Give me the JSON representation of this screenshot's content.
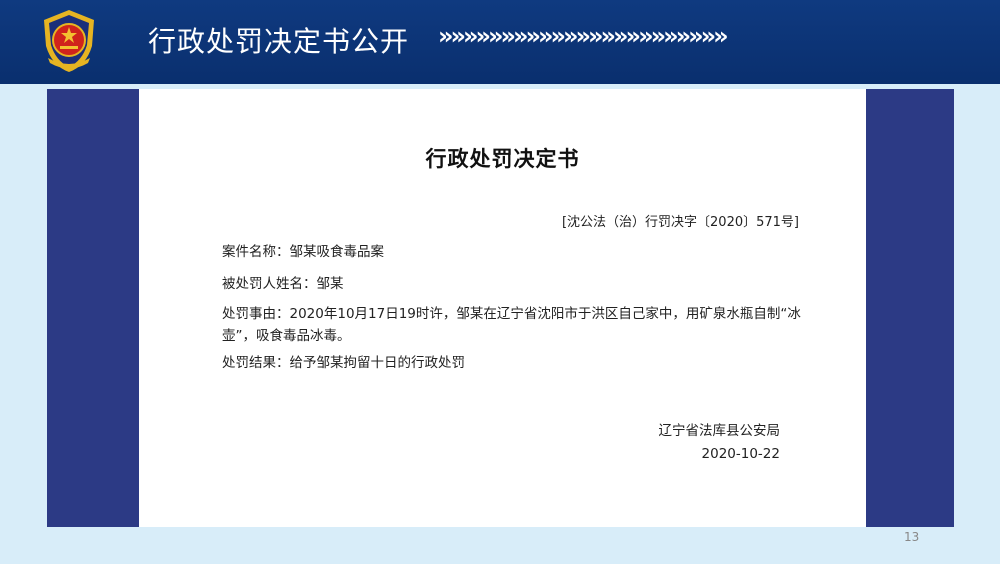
{
  "header": {
    "title": "行政处罚决定书公开",
    "chevrons": "»»»»»»»»»»»»»»»»»»»»»»»",
    "emblem_icon": "police-emblem-icon"
  },
  "document": {
    "title": "行政处罚决定书",
    "number": "[沈公法（治）行罚决字〔2020〕571号]",
    "case_name_label": "案件名称：",
    "case_name": "邹某吸食毒品案",
    "person_label": "被处罚人姓名：",
    "person": "邹某",
    "reason_label": "处罚事由：",
    "reason": "2020年10月17日19时许，邹某在辽宁省沈阳市于洪区自己家中，用矿泉水瓶自制“冰壶”，吸食毒品冰毒。",
    "result_label": "处罚结果：",
    "result": "给予邹某拘留十日的行政处罚",
    "issuer": "辽宁省法库县公安局",
    "date": "2020-10-22"
  },
  "page_number": "13",
  "colors": {
    "header": "#0f3a80",
    "panel": "#2c3a85",
    "background": "#d8edf9",
    "emblem_red": "#d0231c",
    "emblem_gold": "#e6b422"
  }
}
